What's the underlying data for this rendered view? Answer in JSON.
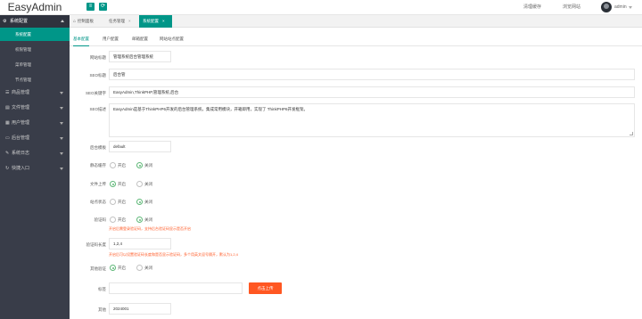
{
  "app": {
    "logo": "EasyAdmin",
    "top_icons": [
      "≡",
      "⟳"
    ],
    "top_links": [
      "清理缓存",
      "浏览网站"
    ],
    "user": "admin"
  },
  "sidebar": {
    "head": "系统配置",
    "subitems": [
      "系统配置",
      "权限管理",
      "菜单管理",
      "节点管理"
    ],
    "items": [
      "商品管理",
      "文件管理",
      "用户管理",
      "后台管理",
      "系统日志",
      "快捷入口"
    ]
  },
  "page_tabs": [
    "控制面板",
    "任务管理",
    "系统配置"
  ],
  "content_tabs": [
    "基本配置",
    "用户配置",
    "邮箱配置",
    "网站站点配置"
  ],
  "form": {
    "site_name": {
      "label": "网站标题",
      "value": "管理系统后台管理系统"
    },
    "seo_title": {
      "label": "SEO标题",
      "value": "后台管"
    },
    "seo_keywords": {
      "label": "SEO关键字",
      "value": "EasyAdmin,ThinkPHP,管理系统,后台"
    },
    "seo_description": {
      "label": "SEO描述",
      "value": "EasyAdmin是基于ThinkPHP6开发的后台管理系统，集成常用模块，开箱即用，实现了 ThinkPHP6开发框架。"
    },
    "theme": {
      "label": "后台模板",
      "value": "default"
    },
    "cache": {
      "label": "静态缓存",
      "options": [
        "开启",
        "关闭"
      ],
      "checked": 1
    },
    "image_water": {
      "label": "文件上传",
      "options": [
        "开启",
        "关闭"
      ],
      "checked": 0
    },
    "site_status": {
      "label": "站点状态",
      "options": [
        "开启",
        "关闭"
      ],
      "checked": 1
    },
    "captcha": {
      "label": "验证码",
      "options": [
        "开启",
        "关闭"
      ],
      "checked": 1,
      "hint": "开启后需登录验证码，支持后台验证码显示是否开启"
    },
    "version": {
      "label": "验证码长度",
      "value": "1,2,4",
      "hint": "开启后可以设置验证码长度和是否显示验证码，多个用英文逗号隔开，默认为1,2,4"
    },
    "login_limit": {
      "label": "其他验证",
      "options": [
        "开启",
        "关闭"
      ],
      "checked": 0
    },
    "logo": {
      "label": "标签",
      "value": "",
      "button": "点击上传"
    },
    "last": {
      "label": "其他",
      "value": "2024001"
    }
  }
}
